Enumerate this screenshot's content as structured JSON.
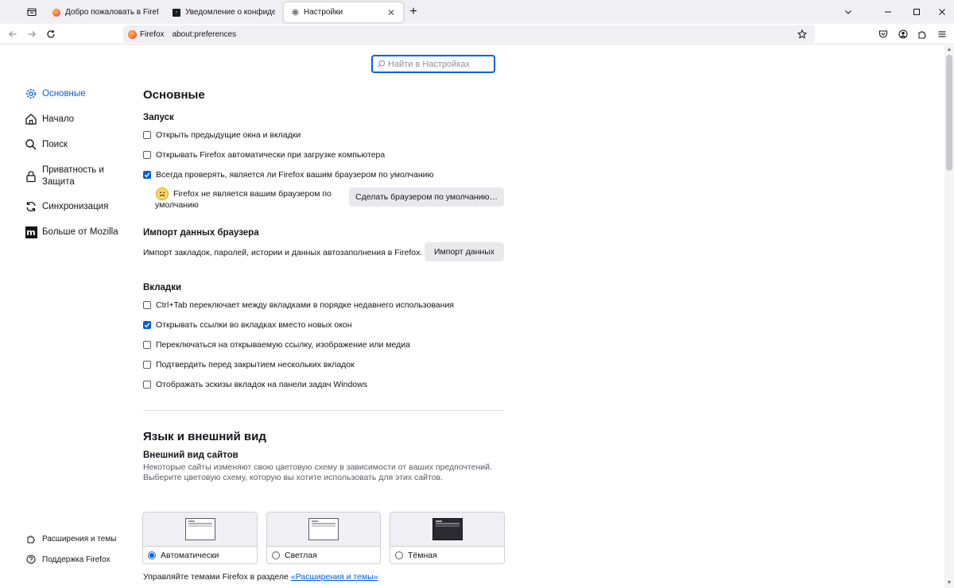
{
  "tabs": [
    {
      "title": "Добро пожаловать в Firefox",
      "favicon": "firefox-icon",
      "active": false
    },
    {
      "title": "Уведомление о конфиденциальности",
      "favicon": "terminal-icon",
      "active": false
    },
    {
      "title": "Настройки",
      "favicon": "gear-icon",
      "active": true
    }
  ],
  "urlbar": {
    "identity": "Firefox",
    "url": "about:preferences"
  },
  "search": {
    "placeholder": "Найти в Настройках"
  },
  "sidebar": {
    "items": [
      {
        "label": "Основные",
        "icon": "gear-icon",
        "active": true
      },
      {
        "label": "Начало",
        "icon": "home-icon"
      },
      {
        "label": "Поиск",
        "icon": "search-icon"
      },
      {
        "label": "Приватность и Защита",
        "icon": "lock-icon"
      },
      {
        "label": "Синхронизация",
        "icon": "sync-icon"
      },
      {
        "label": "Больше от Mozilla",
        "icon": "mozilla-icon"
      }
    ],
    "footer": [
      {
        "label": "Расширения и темы",
        "icon": "puzzle-icon"
      },
      {
        "label": "Поддержка Firefox",
        "icon": "help-icon"
      }
    ]
  },
  "main": {
    "title": "Основные",
    "startup": {
      "heading": "Запуск",
      "options": [
        {
          "label": "Открыть предыдущие окна и вкладки",
          "checked": false
        },
        {
          "label": "Открывать Firefox автоматически при загрузке компьютера",
          "checked": false
        },
        {
          "label": "Всегда проверять, является ли Firefox вашим браузером по умолчанию",
          "checked": true
        }
      ],
      "default_notice_line1": "Firefox не является вашим браузером по",
      "default_notice_line2": "умолчанию",
      "make_default_button": "Сделать браузером по умолчанию…"
    },
    "import": {
      "heading": "Импорт данных браузера",
      "description": "Импорт закладок, паролей, истории и данных автозаполнения в Firefox.",
      "button": "Импорт данных"
    },
    "tabs_section": {
      "heading": "Вкладки",
      "options": [
        {
          "label": "Ctrl+Tab переключает между вкладками в порядке недавнего использования",
          "checked": false
        },
        {
          "label": "Открывать ссылки во вкладках вместо новых окон",
          "checked": true
        },
        {
          "label": "Переключаться на открываемую ссылку, изображение или медиа",
          "checked": false
        },
        {
          "label": "Подтвердить перед закрытием нескольких вкладок",
          "checked": false
        },
        {
          "label": "Отображать эскизы вкладок на панели задач Windows",
          "checked": false
        }
      ]
    },
    "language": {
      "title": "Язык и внешний вид",
      "appearance_heading": "Внешний вид сайтов",
      "appearance_desc_line1": "Некоторые сайты изменяют свою цветовую схему в зависимости от ваших предпочтений.",
      "appearance_desc_line2": "Выберите цветовую схему, которую вы хотите использовать для этих сайтов.",
      "themes": [
        {
          "label": "Автоматически",
          "selected": true
        },
        {
          "label": "Светлая",
          "selected": false
        },
        {
          "label": "Тёмная",
          "selected": false
        }
      ],
      "manage_text": "Управляйте темами Firefox в разделе ",
      "manage_link": "«Расширения и темы»"
    }
  },
  "colors": {
    "accent": "#0061e0",
    "tabstrip": "#f0f0f4",
    "text": "#15141a"
  }
}
